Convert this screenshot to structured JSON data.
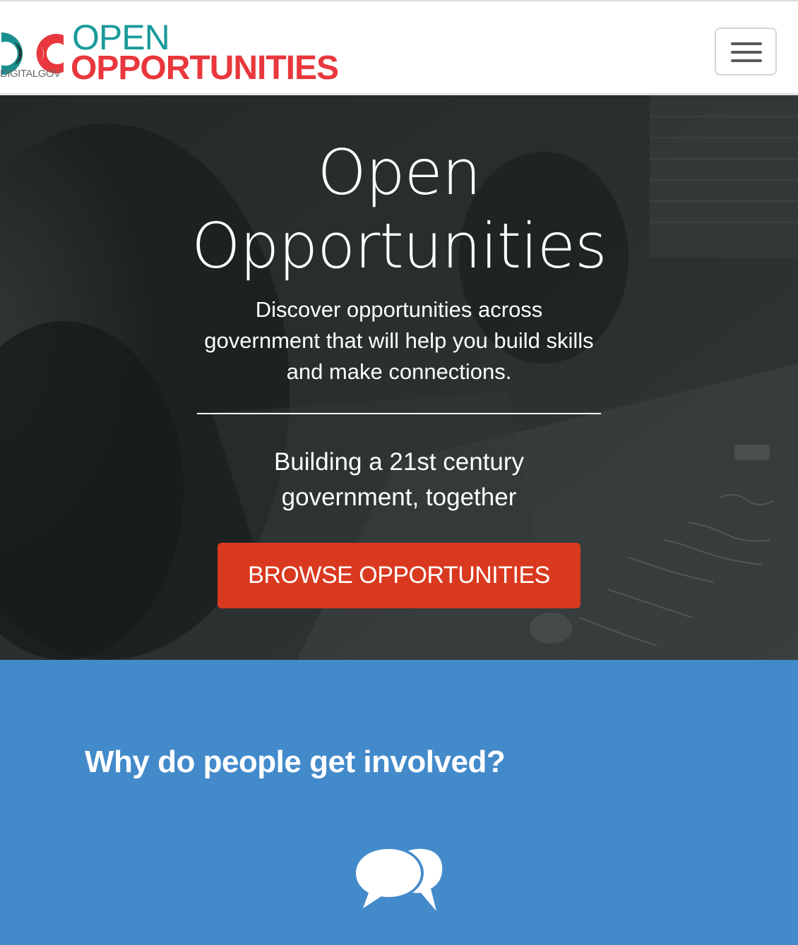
{
  "navbar": {
    "brand_small": "DIGITALGOV",
    "brand_open": "OPEN",
    "brand_opportunities": "OPPORTUNITIES",
    "toggle_icon": "hamburger-menu-icon"
  },
  "hero": {
    "title_line1": "Open",
    "title_line2": "Opportunities",
    "subtitle_line1": "Discover opportunities across",
    "subtitle_line2": "government that will help you build skills",
    "subtitle_line3": "and make connections.",
    "tagline_line1": "Building a 21st century",
    "tagline_line2": "government, together",
    "browse_button": "BROWSE OPPORTUNITIES"
  },
  "why": {
    "heading": "Why do people get involved?",
    "icon": "chat-bubbles-icon"
  },
  "colors": {
    "brand_teal": "#1a9a9a",
    "brand_red": "#e8383d",
    "button_red": "#d9391f",
    "section_blue": "#438acb"
  }
}
